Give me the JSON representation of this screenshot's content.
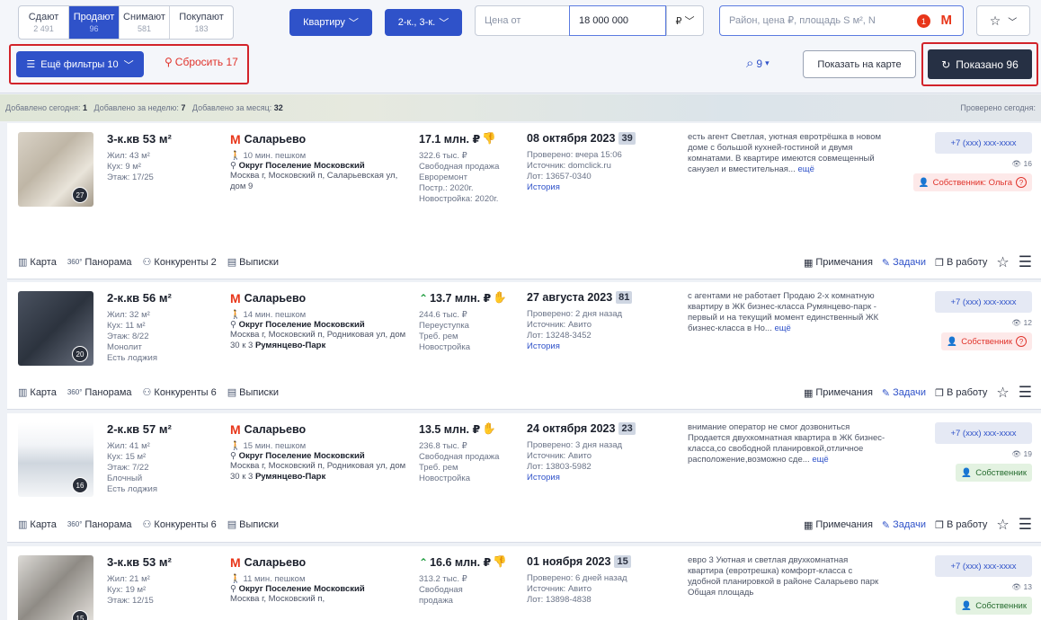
{
  "tabs": [
    {
      "label": "Сдают",
      "count": "2 491"
    },
    {
      "label": "Продают",
      "count": "96"
    },
    {
      "label": "Снимают",
      "count": "581"
    },
    {
      "label": "Покупают",
      "count": "183"
    }
  ],
  "filters": {
    "property_type": "Квартиру",
    "rooms": "2-к., 3-к.",
    "price_from_placeholder": "Цена от",
    "price_to": "18 000 000",
    "currency": "₽",
    "search_placeholder": "Район, цена ₽, площадь S м², N",
    "metro_badge": "1",
    "metro_letter": "M",
    "more_filters": "Ещё фильтры 10",
    "reset": "Сбросить 17",
    "alerts": "9",
    "show_on_map": "Показать на карте",
    "shown": "Показано 96"
  },
  "stats": {
    "today_label": "Добавлено сегодня:",
    "today": "1",
    "week_label": "Добавлено за неделю:",
    "week": "7",
    "month_label": "Добавлено за месяц:",
    "month": "32",
    "checked": "Проверено сегодня:"
  },
  "listings": [
    {
      "title": "3-к.кв 53 м²",
      "living": "Жил: 43 м²",
      "kitchen": "Кух: 9 м²",
      "floor": "Этаж: 17/25",
      "extra1": "",
      "extra2": "",
      "photos": "27",
      "metro": "Саларьево",
      "walk": "10 мин. пешком",
      "okrug": "Округ Поселение Московский",
      "address": "Москва г, Московский п, Саларьевская ул, дом 9",
      "address_bold": "",
      "price": "17.1 млн. ₽",
      "price_prefix": "",
      "per_m": "322.6 тыс. ₽",
      "details": [
        "Свободная продажа",
        "Евроремонт",
        "Постр.: 2020г.",
        "Новостройка: 2020г."
      ],
      "date": "08 октября 2023",
      "days": "39",
      "checked": "Проверено: вчера 15:06",
      "source": "Источник: domclick.ru",
      "lot": "Лот: 13657-0340",
      "history": "История",
      "description": "есть агент Светлая, уютная евротрёшка в новом доме с большой кухней-гостиной и двумя комнатами. В квартире имеются совмещенный санузел и вместительная...",
      "more": "ещё",
      "phone": "+7 (xxx) xxx-xxxx",
      "views": "16",
      "owner": "Собственник: Ольга",
      "counts": {
        "competitors": "Конкуренты 2"
      }
    },
    {
      "title": "2-к.кв 56 м²",
      "living": "Жил: 32 м²",
      "kitchen": "Кух: 11 м²",
      "floor": "Этаж: 8/22",
      "extra1": "Монолит",
      "extra2": "Есть лоджия",
      "photos": "20",
      "metro": "Саларьево",
      "walk": "14 мин. пешком",
      "okrug": "Округ Поселение Московский",
      "address": "Москва г, Московский п, Родниковая ул, дом 30 к 3",
      "address_bold": "Румянцево-Парк",
      "price": "13.7 млн. ₽",
      "price_prefix": "^",
      "per_m": "244.6 тыс. ₽",
      "details": [
        "Переуступка",
        "Треб. рем",
        "Новостройка"
      ],
      "date": "27 августа 2023",
      "days": "81",
      "checked": "Проверено: 2 дня назад",
      "source": "Источник: Авито",
      "lot": "Лот: 13248-3452",
      "history": "История",
      "description": "с агентами не работает Продаю 2-х комнатную квартиру в ЖК бизнес-класса Румянцево-парк - первый и на текущий момент единственный ЖК бизнес-класса в Но...",
      "more": "ещё",
      "phone": "+7 (xxx) xxx-xxxx",
      "views": "12",
      "owner": "Собственник",
      "counts": {
        "competitors": "Конкуренты 6"
      }
    },
    {
      "title": "2-к.кв 57 м²",
      "living": "Жил: 41 м²",
      "kitchen": "Кух: 15 м²",
      "floor": "Этаж: 7/22",
      "extra1": "Блочный",
      "extra2": "Есть лоджия",
      "photos": "16",
      "metro": "Саларьево",
      "walk": "15 мин. пешком",
      "okrug": "Округ Поселение Московский",
      "address": "Москва г, Московский п, Родниковая ул, дом 30 к 3",
      "address_bold": "Румянцево-Парк",
      "price": "13.5 млн. ₽",
      "price_prefix": "",
      "per_m": "236.8 тыс. ₽",
      "details": [
        "Свободная продажа",
        "Треб. рем",
        "Новостройка"
      ],
      "date": "24 октября 2023",
      "days": "23",
      "checked": "Проверено: 3 дня назад",
      "source": "Источник: Авито",
      "lot": "Лот: 13803-5982",
      "history": "История",
      "description": "внимание оператор не смог дозвониться Продается двухкомнатная квартира в ЖК бизнес-класса,со свободной планировкой,отличное расположение,возможно сде...",
      "more": "ещё",
      "phone": "+7 (xxx) xxx-xxxx",
      "views": "19",
      "owner": "Собственник",
      "counts": {
        "competitors": "Конкуренты 6"
      }
    },
    {
      "title": "3-к.кв 53 м²",
      "living": "Жил: 21 м²",
      "kitchen": "Кух: 19 м²",
      "floor": "Этаж: 12/15",
      "extra1": "",
      "extra2": "",
      "photos": "15",
      "metro": "Саларьево",
      "walk": "11 мин. пешком",
      "okrug": "Округ Поселение Московский",
      "address": "Москва г, Московский п,",
      "address_bold": "",
      "price": "16.6 млн. ₽",
      "price_prefix": "^",
      "per_m": "313.2 тыс. ₽",
      "details": [
        "Свободная",
        "продажа"
      ],
      "date": "01 ноября 2023",
      "days": "15",
      "checked": "Проверено: 6 дней назад",
      "source": "Источник: Авито",
      "lot": "Лот: 13898-4838",
      "history": "",
      "description": "евро 3 Уютная и светлая двухкомнатная квартира (евротрешка) комфорт-класса с удобной планировкой в районе Саларьево парк Общая площадь",
      "more": "",
      "phone": "+7 (xxx) xxx-xxxx",
      "views": "13",
      "owner": "Собственник",
      "counts": {
        "competitors": ""
      }
    }
  ],
  "actions": {
    "map": "Карта",
    "panorama": "Панорама",
    "extracts": "Выписки",
    "notes": "Примечания",
    "tasks": "Задачи",
    "to_work": "В работу",
    "panorama_icon": "360°"
  },
  "icons": {
    "more_filters": "sliders-icon",
    "reset": "broom-icon",
    "alerts": "search-bell-icon",
    "refresh": "refresh-icon",
    "metro": "metro-m-icon",
    "walk": "walking-person-icon",
    "pin": "location-pin-icon",
    "dislike": "thumbs-down-icon",
    "hand": "hand-icon",
    "owner": "person-icon",
    "eye": "eye-icon"
  },
  "colors": {
    "accent": "#2f52c9",
    "highlight": "#d2232a",
    "metro": "#e8361a",
    "shown_button": "#263044"
  }
}
